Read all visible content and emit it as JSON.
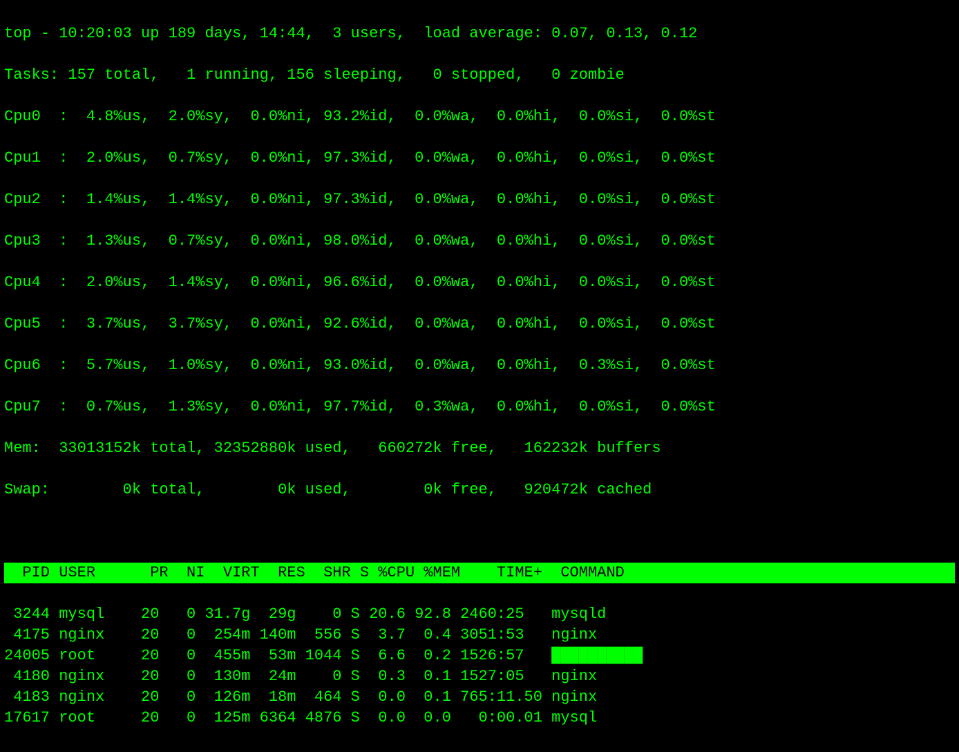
{
  "top": {
    "line": "top - 10:20:03 up 189 days, 14:44,  3 users,  load average: 0.07, 0.13, 0.12",
    "tasks": "Tasks: 157 total,   1 running, 156 sleeping,   0 stopped,   0 zombie",
    "cpus": [
      "Cpu0  :  4.8%us,  2.0%sy,  0.0%ni, 93.2%id,  0.0%wa,  0.0%hi,  0.0%si,  0.0%st",
      "Cpu1  :  2.0%us,  0.7%sy,  0.0%ni, 97.3%id,  0.0%wa,  0.0%hi,  0.0%si,  0.0%st",
      "Cpu2  :  1.4%us,  1.4%sy,  0.0%ni, 97.3%id,  0.0%wa,  0.0%hi,  0.0%si,  0.0%st",
      "Cpu3  :  1.3%us,  0.7%sy,  0.0%ni, 98.0%id,  0.0%wa,  0.0%hi,  0.0%si,  0.0%st",
      "Cpu4  :  2.0%us,  1.4%sy,  0.0%ni, 96.6%id,  0.0%wa,  0.0%hi,  0.0%si,  0.0%st",
      "Cpu5  :  3.7%us,  3.7%sy,  0.0%ni, 92.6%id,  0.0%wa,  0.0%hi,  0.0%si,  0.0%st",
      "Cpu6  :  5.7%us,  1.0%sy,  0.0%ni, 93.0%id,  0.0%wa,  0.0%hi,  0.3%si,  0.0%st",
      "Cpu7  :  0.7%us,  1.3%sy,  0.0%ni, 97.7%id,  0.3%wa,  0.0%hi,  0.0%si,  0.0%st"
    ],
    "mem": "Mem:  33013152k total, 32352880k used,   660272k free,   162232k buffers",
    "swap": "Swap:        0k total,        0k used,        0k free,   920472k cached"
  },
  "header": "  PID USER      PR  NI  VIRT  RES  SHR S %CPU %MEM    TIME+  COMMAND           ",
  "processes": [
    {
      "pid": " 3244",
      "user": "mysql    ",
      "pr": "20",
      "ni": "  0",
      "virt": "31.7g",
      "res": " 29g",
      "shr": "   0",
      "s": "S",
      "cpu": "20.6",
      "mem": "92.8",
      "time": "2460:25   ",
      "cmd": "mysqld"
    },
    {
      "pid": " 4175",
      "user": "nginx    ",
      "pr": "20",
      "ni": "  0",
      "virt": " 254m",
      "res": "140m",
      "shr": " 556",
      "s": "S",
      "cpu": " 3.7",
      "mem": " 0.4",
      "time": "3051:53   ",
      "cmd": "nginx"
    },
    {
      "pid": "24005",
      "user": "root     ",
      "pr": "20",
      "ni": "  0",
      "virt": " 455m",
      "res": " 53m",
      "shr": "1044",
      "s": "S",
      "cpu": " 6.6",
      "mem": " 0.2",
      "time": "1526:57   ",
      "cmd": "██████████"
    },
    {
      "pid": " 4180",
      "user": "nginx    ",
      "pr": "20",
      "ni": "  0",
      "virt": " 130m",
      "res": " 24m",
      "shr": "   0",
      "s": "S",
      "cpu": " 0.3",
      "mem": " 0.1",
      "time": "1527:05   ",
      "cmd": "nginx"
    },
    {
      "pid": " 4183",
      "user": "nginx    ",
      "pr": "20",
      "ni": "  0",
      "virt": " 126m",
      "res": " 18m",
      "shr": " 464",
      "s": "S",
      "cpu": " 0.0",
      "mem": " 0.1",
      "time": "765:11.50 ",
      "cmd": "nginx"
    },
    {
      "pid": "17617",
      "user": "root     ",
      "pr": "20",
      "ni": "  0",
      "virt": " 125m",
      "res": "6364",
      "shr": "4876",
      "s": "S",
      "cpu": " 0.0",
      "mem": " 0.0",
      "time": "  0:00.01 ",
      "cmd": "mysql"
    }
  ]
}
